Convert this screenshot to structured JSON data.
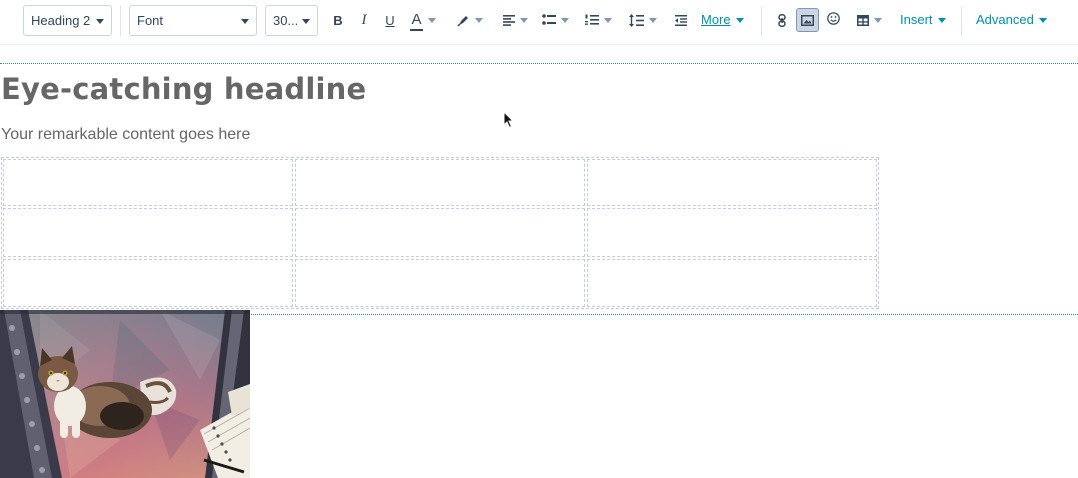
{
  "toolbar": {
    "block_style": "Heading 2",
    "font": "Font",
    "font_size": "30...",
    "more_label": "More",
    "insert_label": "Insert",
    "advanced_label": "Advanced",
    "icons": {
      "bold": "B",
      "italic": "I",
      "underline": "U",
      "text_color": "A"
    },
    "accent_color": "#0091ae"
  },
  "content": {
    "headline": "Eye-catching headline",
    "body": "Your remarkable content goes here",
    "table": {
      "rows": 3,
      "columns": 3
    },
    "image": "cat-on-rug-image"
  }
}
